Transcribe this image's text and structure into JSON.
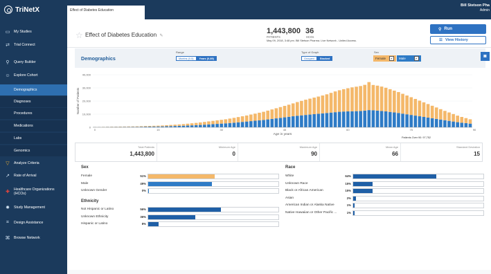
{
  "app": {
    "name": "TriNetX"
  },
  "sidebar": {
    "items": [
      {
        "label": "My Studies",
        "icon": "folder-icon"
      },
      {
        "label": "Trial Connect",
        "icon": "link-icon"
      },
      {
        "label": "Query Builder",
        "icon": "search-icon"
      },
      {
        "label": "Explore Cohort",
        "icon": "person-icon"
      },
      {
        "label": "Demographics",
        "sub": true,
        "active": true
      },
      {
        "label": "Diagnoses",
        "sub": true
      },
      {
        "label": "Procedures",
        "sub": true
      },
      {
        "label": "Medications",
        "sub": true
      },
      {
        "label": "Labs",
        "sub": true
      },
      {
        "label": "Genomics",
        "sub": true
      },
      {
        "label": "Analyze Criteria",
        "icon": "filter-icon"
      },
      {
        "label": "Rate of Arrival",
        "icon": "trend-icon"
      },
      {
        "label": "Healthcare Organizations (HCOs)",
        "icon": "plus-icon"
      },
      {
        "label": "Study Management",
        "icon": "gear-icon"
      },
      {
        "label": "Design Assistance",
        "icon": "grid-icon"
      },
      {
        "label": "Browse Network",
        "icon": "network-icon"
      }
    ]
  },
  "topbar": {
    "tab_label": "Effect of Diabetes Education",
    "user_name": "Bill Stetson Pha",
    "user_role": "Admin"
  },
  "header": {
    "cohort_title": "Effect of Diabetes Education",
    "patients_value": "1,443,800",
    "patients_label": "PATIENTS",
    "hcos_value": "36",
    "hcos_label": "HCOs",
    "note": "May 09, 2018, 3:48 pm.  Bill Stetson Pharma.  Live Network - United Access.",
    "run_label": "Run",
    "history_label": "View History"
  },
  "toolbar": {
    "section_title": "Demographics",
    "range_label": "Range",
    "range_options": [
      "Months (0-5)",
      "Years (0-89)"
    ],
    "graph_label": "Type of Graph",
    "graph_options": [
      "Grouped",
      "Stacked"
    ],
    "sex_label": "Sex",
    "female_label": "Female",
    "male_label": "Male"
  },
  "colors": {
    "female": "#f4b86a",
    "male": "#2e7bc6",
    "nav_bg": "#1b3a5c",
    "accent": "#2e72c2"
  },
  "chart_data": {
    "type": "bar",
    "stacked": true,
    "xlabel": "Age in years",
    "ylabel": "Number of Patients",
    "ylim": [
      0,
      40000
    ],
    "yticks": [
      0,
      10000,
      20000,
      30000,
      40000
    ],
    "ytick_labels": [
      "0",
      "10,000",
      "20,000",
      "30,000",
      "40,000"
    ],
    "xticks": [
      0,
      15,
      30,
      45,
      60,
      75,
      90
    ],
    "xtick_labels": [
      "0",
      "15",
      "30",
      "45",
      "60",
      "75",
      "90"
    ],
    "x": [
      0,
      1,
      2,
      3,
      4,
      5,
      6,
      7,
      8,
      9,
      10,
      11,
      12,
      13,
      14,
      15,
      16,
      17,
      18,
      19,
      20,
      21,
      22,
      23,
      24,
      25,
      26,
      27,
      28,
      29,
      30,
      31,
      32,
      33,
      34,
      35,
      36,
      37,
      38,
      39,
      40,
      41,
      42,
      43,
      44,
      45,
      46,
      47,
      48,
      49,
      50,
      51,
      52,
      53,
      54,
      55,
      56,
      57,
      58,
      59,
      60,
      61,
      62,
      63,
      64,
      65,
      66,
      67,
      68,
      69,
      70,
      71,
      72,
      73,
      74,
      75,
      76,
      77,
      78,
      79,
      80,
      81,
      82,
      83,
      84,
      85,
      86,
      87,
      88,
      89
    ],
    "series": [
      {
        "name": "Male",
        "values": [
          200,
          200,
          200,
          250,
          250,
          300,
          300,
          350,
          350,
          400,
          400,
          450,
          500,
          550,
          600,
          650,
          700,
          800,
          900,
          1000,
          1100,
          1200,
          1350,
          1500,
          1650,
          1800,
          2000,
          2200,
          2400,
          2600,
          2800,
          3000,
          3250,
          3500,
          3800,
          4100,
          4400,
          4700,
          5000,
          5300,
          5600,
          6000,
          6400,
          6800,
          7200,
          7600,
          8000,
          8400,
          8800,
          9100,
          9400,
          9700,
          10000,
          10300,
          10600,
          10900,
          11200,
          11500,
          11800,
          12000,
          12100,
          12200,
          12300,
          12400,
          12700,
          13100,
          13000,
          12700,
          12400,
          12100,
          11700,
          11300,
          10900,
          10400,
          9900,
          9400,
          8900,
          8400,
          7900,
          7400,
          6900,
          6400,
          5900,
          5400,
          4900,
          4400,
          3900,
          3500,
          3200,
          2800
        ]
      },
      {
        "name": "Female",
        "values": [
          100,
          100,
          150,
          150,
          200,
          200,
          250,
          250,
          300,
          300,
          350,
          400,
          450,
          500,
          550,
          600,
          700,
          800,
          900,
          1000,
          1100,
          1250,
          1400,
          1550,
          1700,
          1900,
          2100,
          2300,
          2500,
          2700,
          2900,
          3100,
          3400,
          3700,
          4000,
          4300,
          4600,
          5000,
          5400,
          5800,
          6200,
          6700,
          7200,
          7700,
          8200,
          8700,
          9200,
          9800,
          10400,
          11000,
          11600,
          12100,
          12600,
          13100,
          13600,
          14200,
          15000,
          15800,
          16400,
          17000,
          17600,
          18200,
          18600,
          19000,
          19600,
          21300,
          19200,
          19000,
          18600,
          18000,
          17300,
          16600,
          15900,
          15100,
          14300,
          13500,
          12700,
          11900,
          11100,
          10300,
          9500,
          8700,
          7900,
          7100,
          6400,
          5700,
          5000,
          4400,
          3800,
          3300
        ]
      }
    ],
    "overflow_note": "Patients Over 90: 97,752"
  },
  "stats": [
    {
      "label": "Total Patients",
      "value": "1,443,800"
    },
    {
      "label": "Minimum Age",
      "value": "0"
    },
    {
      "label": "Maximum Age",
      "value": "90"
    },
    {
      "label": "Mean Age",
      "value": "66"
    },
    {
      "label": "Standard Deviation",
      "value": "15"
    }
  ],
  "breakdowns": {
    "sex_title": "Sex",
    "sex": [
      {
        "label": "Female",
        "pct_text": "51%",
        "pct": 51,
        "color": "female"
      },
      {
        "label": "Male",
        "pct_text": "49%",
        "pct": 49,
        "color": "male"
      },
      {
        "label": "Unknown Gender",
        "pct_text": "0%",
        "pct": 0.5,
        "color": "male"
      }
    ],
    "ethnicity_title": "Ethnicity",
    "ethnicity": [
      {
        "label": "Not Hispanic or Latino",
        "pct_text": "56%",
        "pct": 56
      },
      {
        "label": "Unknown Ethnicity",
        "pct_text": "36%",
        "pct": 36
      },
      {
        "label": "Hispanic or Latino",
        "pct_text": "8%",
        "pct": 8
      }
    ],
    "race_title": "Race",
    "race": [
      {
        "label": "White",
        "pct_text": "64%",
        "pct": 64
      },
      {
        "label": "Unknown Race",
        "pct_text": "15%",
        "pct": 15
      },
      {
        "label": "Black or African American",
        "pct_text": "15%",
        "pct": 15
      },
      {
        "label": "Asian",
        "pct_text": "2%",
        "pct": 2
      },
      {
        "label": "American Indian or Alaska Native",
        "pct_text": "1%",
        "pct": 1
      },
      {
        "label": "Native Hawaiian or Other Pacific ...",
        "pct_text": "1%",
        "pct": 1
      }
    ]
  }
}
